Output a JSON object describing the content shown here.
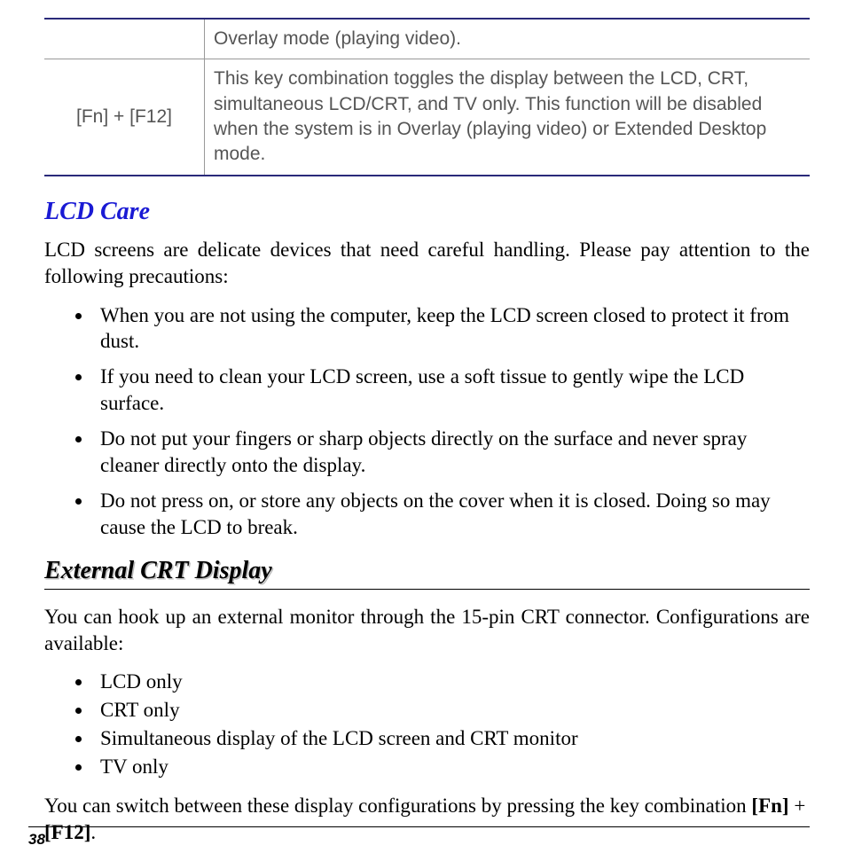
{
  "table": {
    "row0": {
      "left": "",
      "right": "Overlay mode (playing video)."
    },
    "row1": {
      "left": "[Fn] + [F12]",
      "right": "This key combination toggles the display between the LCD, CRT, simultaneous LCD/CRT, and TV only.  This function will be disabled when the system is in Overlay (playing video) or Extended Desktop mode."
    }
  },
  "lcd_care": {
    "heading": "LCD Care",
    "intro": "LCD screens are delicate devices that need careful handling.  Please pay attention to the following precautions:",
    "items": [
      "When you are not using the computer, keep the LCD screen closed to protect it from dust.",
      "If you need to clean your LCD screen, use a soft tissue to gently wipe the LCD surface.",
      "Do not put your fingers or sharp objects directly on the surface and never spray cleaner directly onto the display.",
      "Do not press on, or store any objects on the cover when it is closed.  Doing so may cause the LCD to break."
    ]
  },
  "ext_crt": {
    "heading": "External CRT Display",
    "intro": "You can hook up an external monitor through the 15-pin CRT connector.   Configurations are available:",
    "items": [
      "LCD only",
      "CRT only",
      "Simultaneous display of the LCD screen and CRT monitor",
      "TV only"
    ],
    "outro_prefix": "You can switch between these display configurations by pressing the key combination ",
    "outro_key1": "[Fn]",
    "outro_plus": " + ",
    "outro_key2": "[F12]",
    "outro_suffix": "."
  },
  "page_number": "38"
}
